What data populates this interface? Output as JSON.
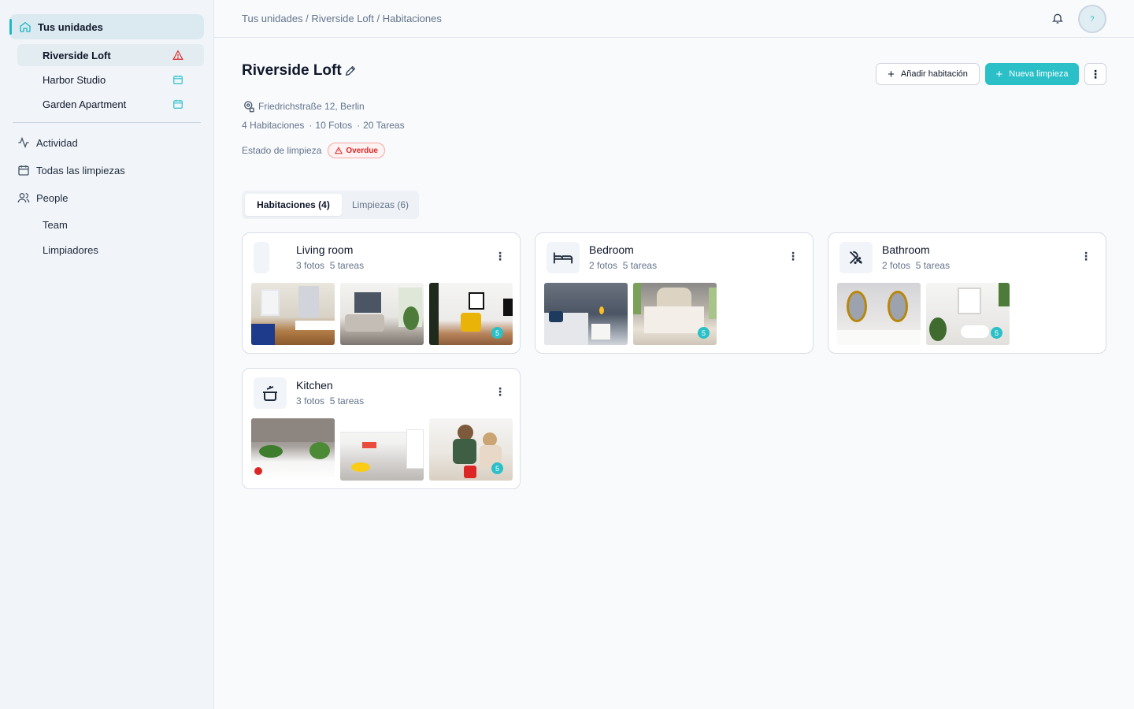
{
  "sidebar": {
    "home_label": "Tus unidades",
    "units": [
      {
        "label": "Riverside Loft",
        "status_icon": "alert-triangle-icon"
      },
      {
        "label": "Harbor Studio",
        "status_icon": "calendar-icon"
      },
      {
        "label": "Garden Apartment",
        "status_icon": "calendar-icon"
      }
    ],
    "nav": [
      {
        "label": "Actividad",
        "icon": "activity-icon"
      },
      {
        "label": "Todas las limpiezas",
        "icon": "calendar-icon"
      },
      {
        "label": "People",
        "icon": "users-icon"
      }
    ],
    "subnav": [
      "Team",
      "Limpiadores"
    ]
  },
  "header": {
    "breadcrumb": "Tus unidades / Riverside Loft / Habitaciones",
    "avatar_text": "?"
  },
  "unit": {
    "title": "Riverside Loft",
    "address": "Friedrichstraße 12, Berlin",
    "stats": {
      "rooms": "4 Habitaciones",
      "photos": "10 Fotos",
      "tasks": "20 Tareas"
    },
    "clean_status_label": "Estado de limpieza",
    "clean_status_badge": "Overdue"
  },
  "actions": {
    "add_room": "Añadir habitación",
    "new_cleaning": "Nueva limpieza",
    "more": "⋮"
  },
  "tabs": [
    {
      "label": "Habitaciones (4)",
      "active": true
    },
    {
      "label": "Limpiezas (6)",
      "active": false
    }
  ],
  "rooms": [
    {
      "name": "Living room",
      "photos": "3 fotos",
      "tasks": "5 tareas",
      "icon": "none",
      "badge": "5"
    },
    {
      "name": "Bedroom",
      "photos": "2 fotos",
      "tasks": "5 tareas",
      "icon": "bed-icon",
      "badge": "5"
    },
    {
      "name": "Bathroom",
      "photos": "2 fotos",
      "tasks": "5 tareas",
      "icon": "shower-icon",
      "badge": "5"
    },
    {
      "name": "Kitchen",
      "photos": "3 fotos",
      "tasks": "5 tareas",
      "icon": "cooking-pot-icon",
      "badge": "5"
    }
  ],
  "colors": {
    "accent": "#2bc0c8",
    "danger": "#dc2626"
  }
}
